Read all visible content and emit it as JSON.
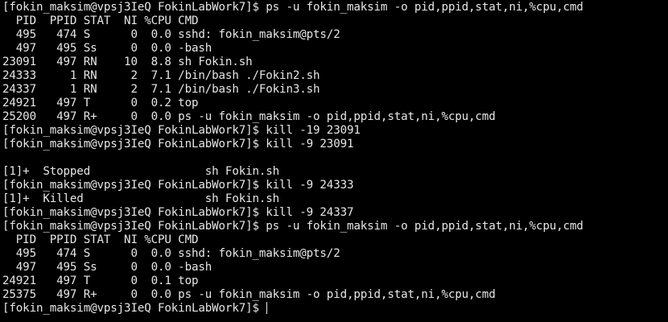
{
  "terminal": {
    "lines": [
      "[fokin_maksim@vpsj3IeQ FokinLabWork7]$ ps -u fokin_maksim -o pid,ppid,stat,ni,%cpu,cmd",
      "  PID  PPID STAT  NI %CPU CMD",
      "  495   474 S      0  0.0 sshd: fokin_maksim@pts/2",
      "  497   495 Ss     0  0.0 -bash",
      "23091   497 RN    10  8.8 sh Fokin.sh",
      "24333     1 RN     2  7.1 /bin/bash ./Fokin2.sh",
      "24337     1 RN     2  7.1 /bin/bash ./Fokin3.sh",
      "24921   497 T      0  0.2 top",
      "25200   497 R+     0  0.0 ps -u fokin_maksim -o pid,ppid,stat,ni,%cpu,cmd",
      "[fokin_maksim@vpsj3IeQ FokinLabWork7]$ kill -19 23091",
      "[fokin_maksim@vpsj3IeQ FokinLabWork7]$ kill -9 23091",
      "",
      "[1]+  Stopped                 sh Fokin.sh",
      "[fokin_maksim@vpsj3IeQ FokinLabWork7]$ kill -9 24333",
      "[1]+  Killed                  sh Fokin.sh",
      "[fokin_maksim@vpsj3IeQ FokinLabWork7]$ kill -9 24337",
      "[fokin_maksim@vpsj3IeQ FokinLabWork7]$ ps -u fokin_maksim -o pid,ppid,stat,ni,%cpu,cmd",
      "  PID  PPID STAT  NI %CPU CMD",
      "  495   474 S      0  0.0 sshd: fokin_maksim@pts/2",
      "  497   495 Ss     0  0.0 -bash",
      "24921   497 T      0  0.1 top",
      "25375   497 R+     0  0.0 ps -u fokin_maksim -o pid,ppid,stat,ni,%cpu,cmd"
    ],
    "prompt": "[fokin_maksim@vpsj3IeQ FokinLabWork7]$ ",
    "colors": {
      "background": "#000000",
      "foreground": "#e6e6e6"
    }
  }
}
